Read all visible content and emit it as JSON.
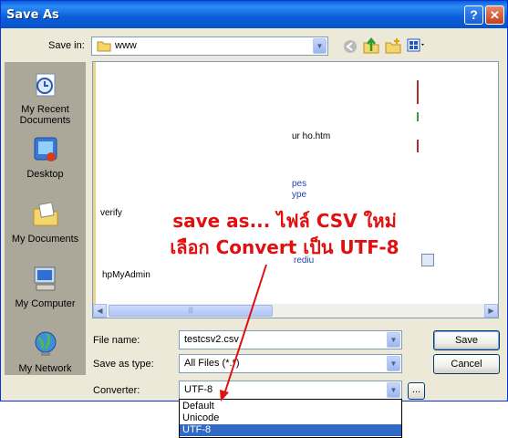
{
  "window": {
    "title": "Save As"
  },
  "toolbar": {
    "save_in_label": "Save in:",
    "folder": "www",
    "icons": [
      "back-icon",
      "up-folder-icon",
      "new-folder-icon",
      "views-menu-icon"
    ]
  },
  "places": [
    {
      "label": "My Recent Documents",
      "icon": "recent-documents-icon"
    },
    {
      "label": "Desktop",
      "icon": "desktop-icon"
    },
    {
      "label": "My Documents",
      "icon": "my-documents-icon"
    },
    {
      "label": "My Computer",
      "icon": "my-computer-icon"
    },
    {
      "label": "My Network",
      "icon": "my-network-icon"
    }
  ],
  "filelist": {
    "visible_fragments": [
      "ur    ho.htm",
      "verify",
      "hpMyAdmin",
      "rediu",
      "pes",
      "ype"
    ]
  },
  "form": {
    "file_name_label": "File name:",
    "file_name_value": "testcsv2.csv",
    "save_type_label": "Save as type:",
    "save_type_value": "All Files (*.*)",
    "converter_label": "Converter:",
    "converter_value": "UTF-8",
    "options_button": "..."
  },
  "buttons": {
    "save": "Save",
    "cancel": "Cancel"
  },
  "converter_dropdown": {
    "options": [
      "Default",
      "Unicode",
      "UTF-8"
    ],
    "selected": "UTF-8"
  },
  "annotation": {
    "line1": "save as... ไฟล์ CSV ใหม่",
    "line2": "เลือก Convert เป็น UTF-8",
    "color": "#e01010"
  },
  "colors": {
    "titlebar": "#0a5fd8",
    "dialog": "#ece9d8",
    "selection": "#316ac5"
  }
}
